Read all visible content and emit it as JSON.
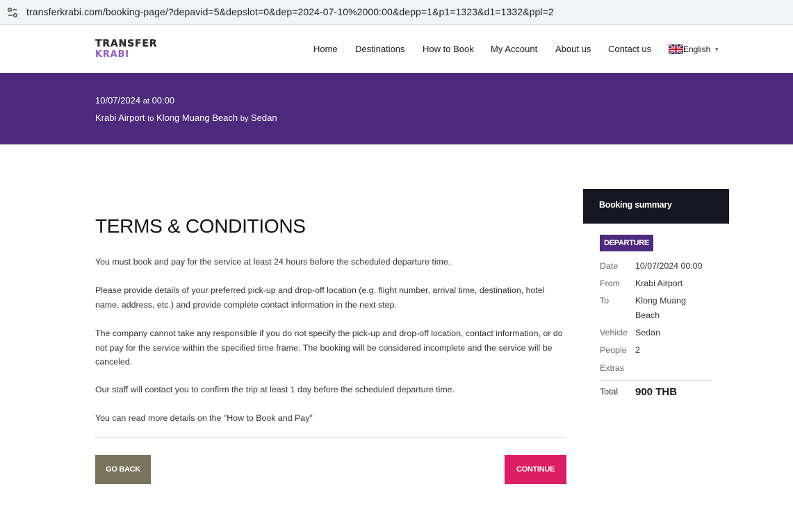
{
  "browser": {
    "url": "transferkrabi.com/booking-page/?depavid=5&depslot=0&dep=2024-07-10%2000:00&depp=1&p1=1323&d1=1332&ppl=2"
  },
  "header": {
    "logo_top": "TRANSFER",
    "logo_bottom": "KRABI",
    "nav": [
      "Home",
      "Destinations",
      "How to Book",
      "My Account",
      "About us",
      "Contact us"
    ],
    "language": "English"
  },
  "banner": {
    "date": "10/07/2024",
    "at": "at",
    "time": "00:00",
    "from": "Krabi Airport",
    "to_word": "to",
    "to": "Klong Muang Beach",
    "by_word": "by",
    "vehicle": "Sedan"
  },
  "terms": {
    "title": "TERMS & CONDITIONS",
    "paragraphs": [
      "You must book and pay for the service at least 24 hours before the scheduled departure time.",
      "Please provide details of your preferred pick-up and drop-off location (e.g. flight number, arrival time, destination, hotel name, address, etc.) and provide complete contact information in the next step.",
      "The company cannot take any responsible if you do not specify the pick-up and drop-off location, contact information, or do not pay for the service within the specified time frame. The booking will be considered incomplete and the service will be canceled.",
      "Our staff will contact you to confirm the trip at least 1 day before the scheduled departure time.",
      "You can read more details on the \"How to Book and Pay\""
    ],
    "back_label": "GO BACK",
    "continue_label": "CONTINUE"
  },
  "summary": {
    "title": "Booking summary",
    "badge": "DEPARTURE",
    "rows": [
      {
        "key": "Date",
        "value": "10/07/2024 00:00"
      },
      {
        "key": "From",
        "value": "Krabi Airport"
      },
      {
        "key": "To",
        "value": "Klong Muang Beach"
      },
      {
        "key": "Vehicle",
        "value": "Sedan"
      },
      {
        "key": "People",
        "value": "2"
      },
      {
        "key": "Extras",
        "value": ""
      }
    ],
    "total_label": "Total",
    "total_value": "900 THB"
  },
  "colors": {
    "banner": "#4e2a7e",
    "continue": "#dd1e63",
    "back": "#7a735c",
    "summary_head": "#161722"
  },
  "icons": [
    "site-info-icon",
    "uk-flag-icon",
    "caret-down-icon"
  ]
}
